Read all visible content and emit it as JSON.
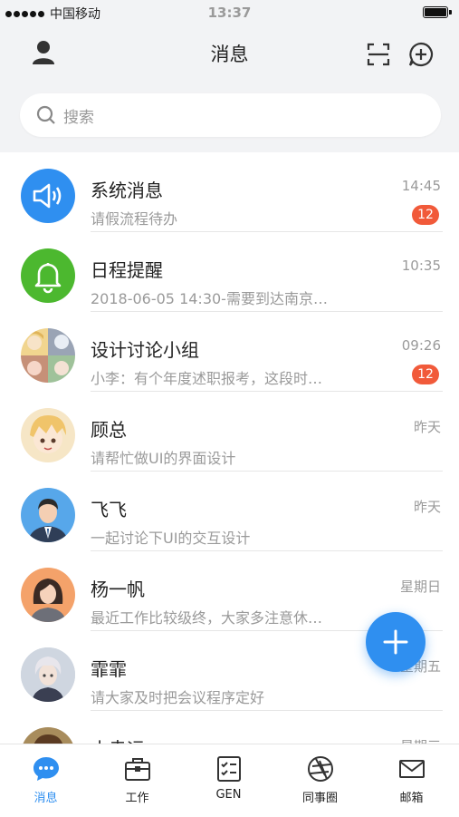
{
  "status_bar": {
    "carrier": "中国移动",
    "time": "13:37"
  },
  "header": {
    "title": "消息"
  },
  "search": {
    "placeholder": "搜索"
  },
  "conversations": [
    {
      "name": "系统消息",
      "preview": "请假流程待办",
      "time": "14:45",
      "badge": "12",
      "avatar_icon": "speaker-icon",
      "avatar_color": "#2f8ff0"
    },
    {
      "name": "日程提醒",
      "preview": "2018-06-05 14:30-需要到达南京…",
      "time": "10:35",
      "badge": "",
      "avatar_icon": "bell-icon",
      "avatar_color": "#4cb82f"
    },
    {
      "name": "设计讨论小组",
      "preview": "小李：有个年度述职报考，这段时…",
      "time": "09:26",
      "badge": "12",
      "avatar_icon": "group-avatar",
      "avatar_color": "#d9c7a6"
    },
    {
      "name": "顾总",
      "preview": "请帮忙做UI的界面设计",
      "time": "昨天",
      "badge": "",
      "avatar_icon": "anime-avatar",
      "avatar_color": "#f3d9a4"
    },
    {
      "name": "飞飞",
      "preview": "一起讨论下UI的交互设计",
      "time": "昨天",
      "badge": "",
      "avatar_icon": "man-avatar",
      "avatar_color": "#57a7ea"
    },
    {
      "name": "杨一帆",
      "preview": "最近工作比较级终，大家多注意休…",
      "time": "星期日",
      "badge": "",
      "avatar_icon": "woman-avatar",
      "avatar_color": "#f4a26a"
    },
    {
      "name": "霏霏",
      "preview": "请大家及时把会议程序定好",
      "time": "星期五",
      "badge": "",
      "avatar_icon": "portrait-avatar",
      "avatar_color": "#8fa0b8"
    },
    {
      "name": "小幸运",
      "preview": "",
      "time": "星期三",
      "badge": "",
      "avatar_icon": "anime-avatar",
      "avatar_color": "#a88c5c"
    }
  ],
  "tabbar": [
    {
      "label": "消息",
      "icon": "chat-bubble-icon",
      "active": true
    },
    {
      "label": "工作",
      "icon": "briefcase-icon",
      "active": false
    },
    {
      "label": "GEN",
      "icon": "checklist-icon",
      "active": false
    },
    {
      "label": "同事圈",
      "icon": "aperture-icon",
      "active": false
    },
    {
      "label": "邮箱",
      "icon": "mail-icon",
      "active": false
    }
  ],
  "colors": {
    "accent": "#2f8ff0",
    "badge": "#f15a3a",
    "green": "#4cb82f"
  }
}
